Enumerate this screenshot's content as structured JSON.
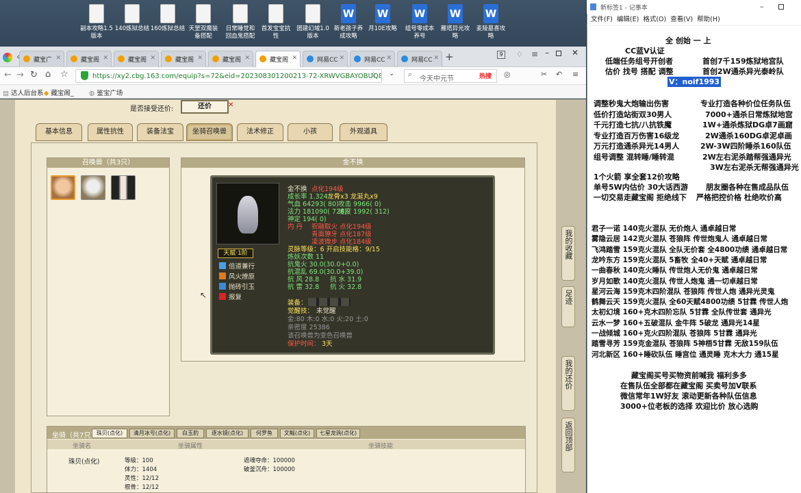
{
  "desktop": {
    "icons": [
      {
        "label": "副本攻略1.5\n版本",
        "type": "doc"
      },
      {
        "label": "140炼狱总结",
        "type": "doc"
      },
      {
        "label": "160炼狱总结",
        "type": "doc"
      },
      {
        "label": "天罡双魔装\n备搭配",
        "type": "doc"
      },
      {
        "label": "日常睡觉和\n回血鬼搭配",
        "type": "doc"
      },
      {
        "label": "首发宝宝抗\n性",
        "type": "doc"
      },
      {
        "label": "团建幻域1.0\n版本",
        "type": "doc"
      },
      {
        "label": "新老孩子养\n成攻略",
        "type": "wps"
      },
      {
        "label": "月10E攻略",
        "type": "wps"
      },
      {
        "label": "组号零成本\n养号",
        "type": "wps"
      },
      {
        "label": "雁塔异光攻\n略",
        "type": "wps"
      },
      {
        "label": "麦陵墓喜攻\n略",
        "type": "wps"
      }
    ]
  },
  "browser": {
    "tabs": [
      "藏宝广",
      "藏宝阁",
      "藏宝阁",
      "藏宝阁",
      "藏宝阁",
      "藏宝阁",
      "网易CC",
      "网易CC",
      "网易CC"
    ],
    "tab_count": "9",
    "url": "https://xy2.cbg.163.com/equip?s=72&eid=202308301200213-72-XRWVGBAYOBUQ8&",
    "search_placeholder": "今天中元节",
    "hot_label": "热搜",
    "bookmarks": [
      "达人后台系",
      "藏宝阁_",
      "鉴宝广场"
    ]
  },
  "page": {
    "bargain_label": "是否接受还价:",
    "bargain_button": "还价",
    "tabs": [
      "基本信息",
      "属性抗性",
      "装备法宝",
      "坐骑召唤兽",
      "法术修正",
      "小孩",
      "外观道具"
    ],
    "pets_title": "召唤兽（共3只）",
    "pet_name_title": "金不换",
    "card": {
      "name": "金不换",
      "level": "点化194级",
      "growth": "成长率 1.324",
      "bones": "龙骨x3 龙涎丸x9",
      "hp": "气血 64293( 80)",
      "atk": "攻击 9966( 0)",
      "mp": "法力 181090( 726)",
      "spd": "速度 1992( 312)",
      "spirit": "神定 194( 0)",
      "nei_label": "内  丹",
      "nei1": "祝融取火 点化194级",
      "nei2": "青面獠牙 点化187级",
      "nei3": "凌波微步 点化184级",
      "talent_label": "天赋·1阶",
      "skills": [
        "倍道兼行",
        "风火燎原",
        "抛砖引玉",
        "报复"
      ],
      "spirit_level": "灵脉等级：6 开启技能格：9/15",
      "train": "炼妖次数 11",
      "r1a": "抗鬼火 30.0(30.0+0.0)",
      "r2a": "抗混乱 69.0(30.0+39.0)",
      "r3a": "抗  风 28.8",
      "r3b": "抗  水 31.9",
      "r4a": "抗  雷 32.8",
      "r4b": "抗  火 32.8",
      "equip_label": "装备：",
      "awaken_label": "觉醒技：",
      "awaken_value": "未觉醒",
      "elements": "金:80 木:0 水:0 火:20 土:0",
      "affinity": "亲密度 25386",
      "change": "该召唤兽为变色召唤兽",
      "protect_label": "保护时间：",
      "protect_value": "3天"
    },
    "side_buttons": [
      "我的收藏",
      "足迹",
      "我的还价",
      "返回顶部"
    ],
    "mount_title": "坐骑（共7只）",
    "mount_tabs": [
      "珠贝(点化)",
      "清月冰号(点化)",
      "白玉豹",
      "逐水镜(点化)",
      "何罗鱼",
      "文鳐(点化)",
      "七星龙驹(点化)"
    ],
    "mount_headers": [
      "坐骑名",
      "坐骑属性",
      "坐骑技能"
    ],
    "mount": {
      "name": "珠贝(点化)",
      "level": "等级：100",
      "stamina": "体力：1404",
      "spirit": "灵性：12/12",
      "bone": "根骨：12/12",
      "skill1": "遮魂夺命：100000",
      "skill2": "破釜沉舟：100000"
    }
  },
  "notepad": {
    "title": "新标签1 - 记事本",
    "menu": [
      "文件(F)",
      "编辑(E)",
      "格式(O)",
      "查看(V)",
      "帮助(H)"
    ],
    "header_lines": [
      "全  创始   一    上",
      "CC蓝V认证",
      "低端任务组号开创者",
      "首创7千159炼狱地宫队",
      "估价 找号 搭配 调整",
      "首创2W通杀异光泰岭队"
    ],
    "vx": "V：noif1993",
    "left_col": [
      "调整秒鬼大炮输出伤害",
      "低价打造站街双30男人",
      "千元打造七抗/八抗铁魔",
      "专业打造百万伤害16级龙",
      "万元打造通杀异光14男人",
      "组号调整 混转睡/睡转混"
    ],
    "right_col": [
      "专业打造各种价位任务队伍",
      "7000+通杀日常炼狱地宫",
      "1W+通杀炼狱DG卓7画窟",
      "2W通杀160DG卓泥卓画",
      "2W-3W四阶睡杀160队伍",
      "2W左右泥杀踏帮强通异光",
      "3W左右泥杀无帮强通异光"
    ],
    "mid_lines": [
      "1个火箭 享全套12价攻略",
      "单号5W内估价 30大话西游",
      "朋友圈各种在售成品队伍",
      "一切交易走藏宝阁 拒绝线下",
      "严格把控价格 杜绝吹价高"
    ],
    "teams": [
      "君子一诺 140克火混队 无价炮人 通卓越日常",
      "雾隐云居 142克火混队 苍狼阵 传世炮鬼人 通卓越日常",
      "飞鸿踏雪 159克火混队 全队无价套 全4800功绩 通卓越日常",
      "龙吟东方 159克火混队 5畜牧 全40+天赋 通卓越日常",
      "一曲春秋 140克火睡队 传世炮人无价鬼 通卓越日常",
      "岁月如歌 140克火混队 传世人炮鬼 通一切卓越日常",
      "星河云海 159克木四阶混队 苍狼阵 传世人炮 通异光灵鬼",
      "鹤舞云天 159克火混队 全60天赋4800功绩 5甘霖 传世人炮",
      "太初幻境 160+克木四阶忘队 5甘霖 全队传世套 通异光",
      "云水一梦 160+五破混队 金牛阵 5破龙 通异光14星",
      "一战倾城 160+克火四阶混队 苍狼阵 5甘霖 通异光",
      "踏雪寻芳 159克金混队 苍狼阵 5神梧5甘霖 无敌159队伍",
      "河北新区 160+睡砍队伍 睡宫位 通灵睡 克木大力 通15星"
    ],
    "footer": [
      "藏宝阁买号买物资前喊我 福利多多",
      "在售队伍全部都在藏宝阁 买卖号加V联系",
      "微信常年1W好友 滚动更新各种队伍信息",
      "3000+位老板的选择 欢迎比价 放心选购"
    ]
  },
  "colors": {
    "accent_red": "#ff5a4a",
    "skill_yellow": "#ffe45c",
    "vx_highlight": "#1f5fd1"
  }
}
